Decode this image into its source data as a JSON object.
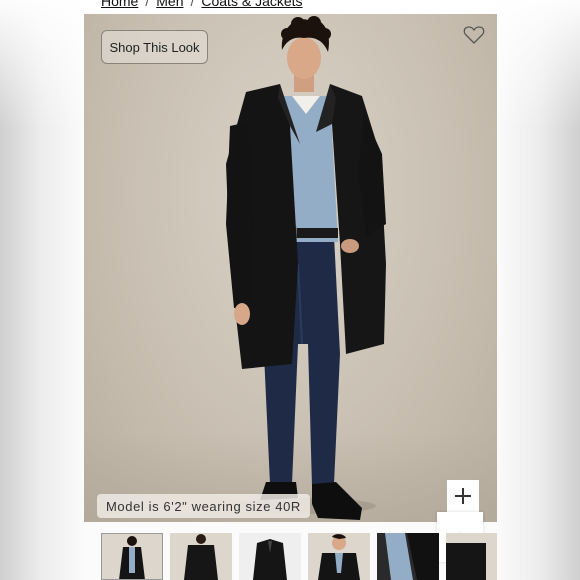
{
  "breadcrumb": {
    "items": [
      "Home",
      "Men",
      "Coats & Jackets"
    ],
    "separator": "/"
  },
  "product_image": {
    "shop_look_label": "Shop This Look",
    "model_note": "Model is 6'2\" wearing size 40R",
    "wishlist_icon": "heart-outline-icon",
    "zoom_icon": "plus-icon"
  },
  "scroll_top_icon": "chevron-up-icon",
  "thumbnails": [
    "front-full",
    "back-detail",
    "flat-lay",
    "front-closeup",
    "fabric-detail",
    "partial"
  ],
  "colors": {
    "background": "#c9c0b3",
    "coat": "#151515",
    "shirt": "#8fa9c2",
    "jeans": "#1e2a44"
  }
}
